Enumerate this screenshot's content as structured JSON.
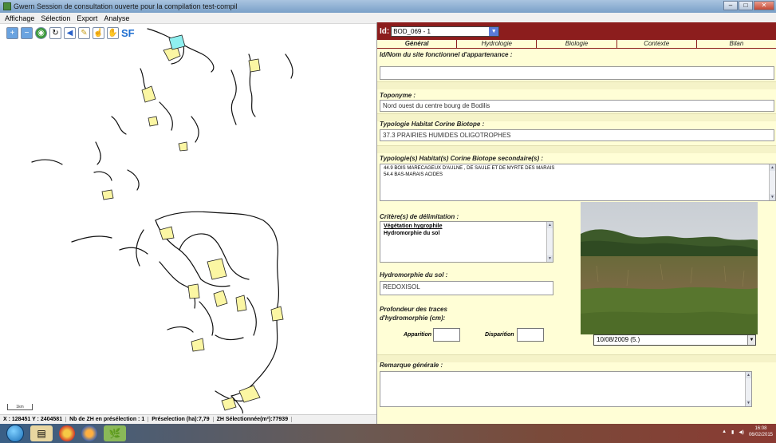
{
  "window": {
    "title": "Gwern  Session de consultation ouverte  pour la compilation test-compil",
    "min_label": "–",
    "max_label": "□",
    "close_label": "✕"
  },
  "menu": [
    "Affichage",
    "Sélection",
    "Export",
    "Analyse"
  ],
  "toolbar": {
    "sf_label": "SF",
    "icons": [
      "zoom-in-icon",
      "zoom-out-icon",
      "globe-icon",
      "refresh-icon",
      "back-arrow-icon",
      "pencil-icon",
      "select-pointer-icon",
      "pan-hand-icon"
    ]
  },
  "map": {
    "scalebar_label": "1km"
  },
  "statusbar": {
    "coords": "X : 128451  Y : 2404581",
    "nb_zh": "Nb de ZH en présélection : 1",
    "preselection": "Préselection (ha):7,79",
    "zh_selected": "ZH Sélectionnée(m²):77939"
  },
  "panel": {
    "id_label": "Id:",
    "id_value": "BOD_069 - 1",
    "tabs": [
      "Général",
      "Hydrologie",
      "Biologie",
      "Contexte",
      "Bilan"
    ],
    "active_tab": "Général",
    "site_label": "Id/Nom du site fonctionnel d'appartenance :",
    "site_value": "",
    "toponyme_label": "Toponyme :",
    "toponyme_value": "Nord ouest du centre bourg de Bodilis",
    "typologie_label": "Typologie Habitat Corine Biotope :",
    "typologie_value": "37.3  PRAIRIES HUMIDES OLIGOTROPHES",
    "typologie_sec_label": "Typologie(s) Habitat(s) Corine Biotope secondaire(s) :",
    "typologie_sec_items": [
      "44.9  BOIS MARECAGEUX D'AULNE , DE SAULE ET DE MYRTE DES MARAIS",
      "54.4  BAS-MARAIS ACIDES"
    ],
    "criteres_label": "Critère(s) de délimitation :",
    "criteres_items": [
      "Végétation hygrophile",
      "Hydromorphie du sol"
    ],
    "hydro_label": "Hydromorphie du sol :",
    "hydro_value": "REDOXISOL",
    "profondeur_label": "Profondeur des traces d'hydromorphie (cm):",
    "apparition_label": "Apparition",
    "disparition_label": "Disparition",
    "photo_date": "10/08/2009 (5.)",
    "remarque_label": "Remarque générale :"
  },
  "taskbar": {
    "clock_time": "16:08",
    "clock_date": "06/02/2015"
  }
}
